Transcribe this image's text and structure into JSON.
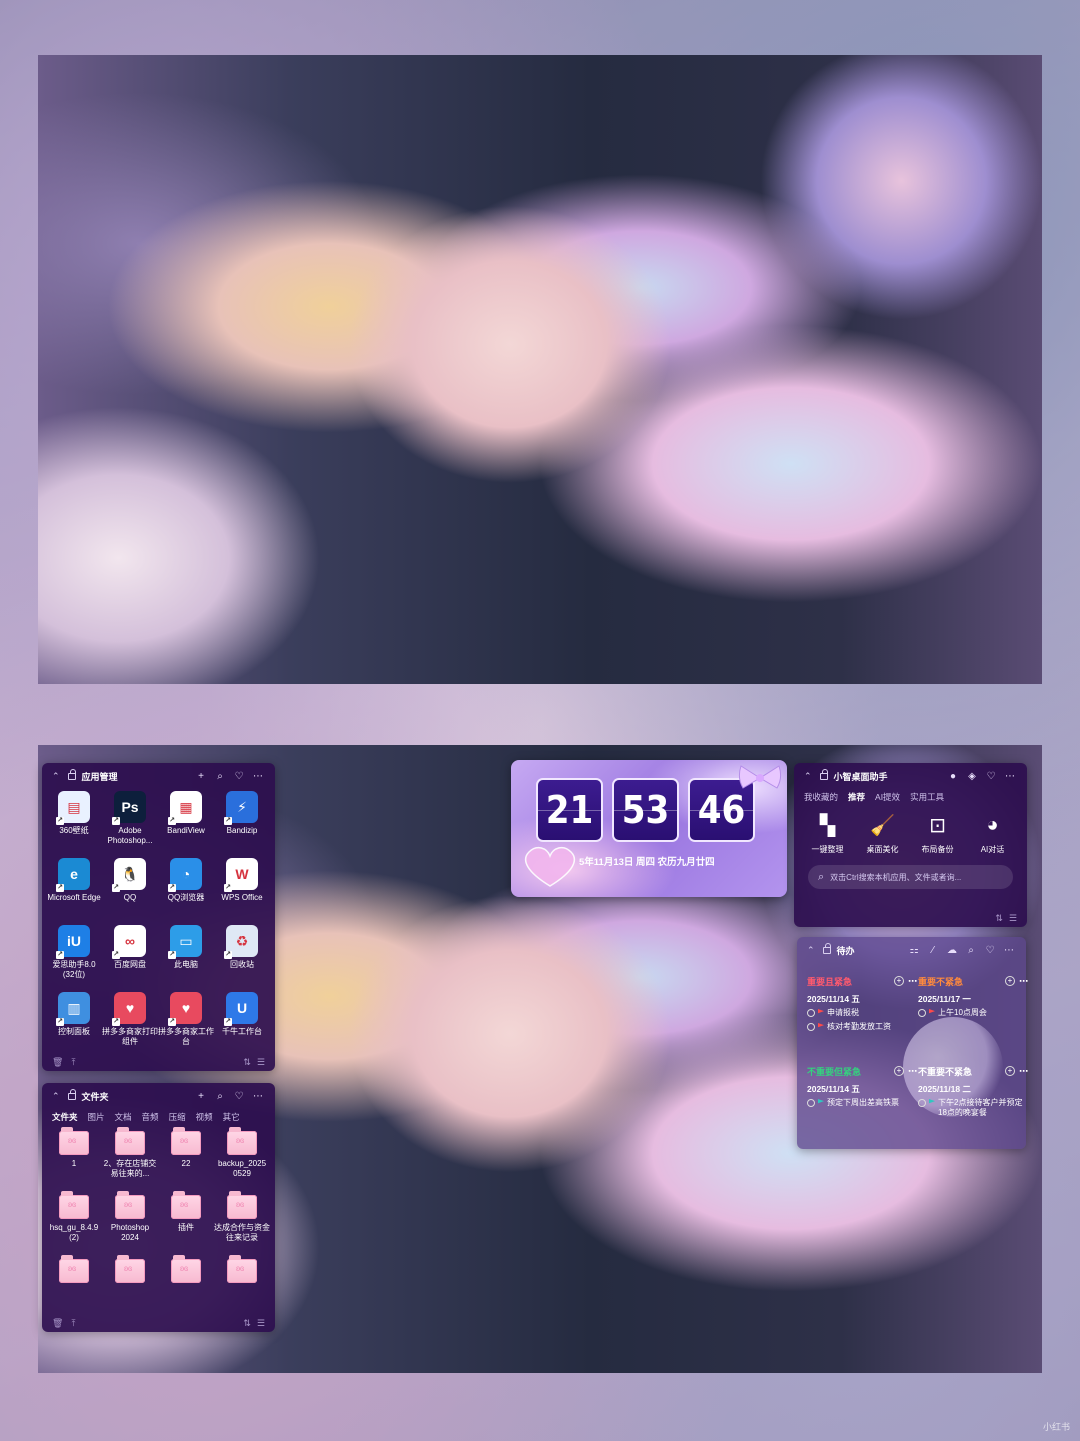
{
  "app_panel": {
    "title": "应用管理",
    "apps": [
      {
        "label": "360壁纸",
        "icon": "360-wallpaper-icon",
        "color": "#e9f1ff",
        "glyph": "▤"
      },
      {
        "label": "Adobe Photoshop...",
        "icon": "photoshop-icon",
        "color": "#0d1f3c",
        "glyph": "Ps"
      },
      {
        "label": "BandiView",
        "icon": "bandiview-icon",
        "color": "#ffffff",
        "glyph": "▦"
      },
      {
        "label": "Bandizip",
        "icon": "bandizip-icon",
        "color": "#2a6fdc",
        "glyph": "⚡"
      },
      {
        "label": "Microsoft Edge",
        "icon": "edge-icon",
        "color": "#1b8ad3",
        "glyph": "e"
      },
      {
        "label": "QQ",
        "icon": "qq-icon",
        "color": "#ffffff",
        "glyph": "🐧"
      },
      {
        "label": "QQ浏览器",
        "icon": "qq-browser-icon",
        "color": "#2a8fe8",
        "glyph": "◔"
      },
      {
        "label": "WPS Office",
        "icon": "wps-office-icon",
        "color": "#ffffff",
        "glyph": "W"
      },
      {
        "label": "爱思助手8.0 (32位)",
        "icon": "i4-assistant-icon",
        "color": "#1e7fe6",
        "glyph": "iU"
      },
      {
        "label": "百度网盘",
        "icon": "baidu-netdisk-icon",
        "color": "#ffffff",
        "glyph": "∞"
      },
      {
        "label": "此电脑",
        "icon": "this-pc-icon",
        "color": "#2d9de8",
        "glyph": "▭"
      },
      {
        "label": "回收站",
        "icon": "recycle-bin-icon",
        "color": "#dfe8f5",
        "glyph": "♻"
      },
      {
        "label": "控制面板",
        "icon": "control-panel-icon",
        "color": "#3f8fe0",
        "glyph": "▥"
      },
      {
        "label": "拼多多商家打印组件",
        "icon": "pdd-print-icon",
        "color": "#e84a5f",
        "glyph": "♥"
      },
      {
        "label": "拼多多商家工作台",
        "icon": "pdd-workbench-icon",
        "color": "#e84a5f",
        "glyph": "♥"
      },
      {
        "label": "千牛工作台",
        "icon": "qianniu-icon",
        "color": "#2e79e8",
        "glyph": "U"
      }
    ]
  },
  "folder_panel": {
    "title": "文件夹",
    "tabs": [
      "文件夹",
      "图片",
      "文档",
      "音频",
      "压缩",
      "视频",
      "其它"
    ],
    "active_tab": "文件夹",
    "folders": [
      {
        "label": "1"
      },
      {
        "label": "2、存在店铺交易往来的..."
      },
      {
        "label": "22"
      },
      {
        "label": "backup_2025 0529"
      },
      {
        "label": "hsq_gu_8.4.9 (2)"
      },
      {
        "label": "Photoshop 2024"
      },
      {
        "label": "插件"
      },
      {
        "label": "达成合作与资金往来记录"
      },
      {
        "label": ""
      },
      {
        "label": ""
      },
      {
        "label": ""
      },
      {
        "label": ""
      }
    ]
  },
  "clock": {
    "hours": "21",
    "minutes": "53",
    "seconds": "46",
    "date_line": "5年11月13日 周四 农历九月廿四"
  },
  "assistant": {
    "title": "小智桌面助手",
    "tabs": [
      "我收藏的",
      "推荐",
      "AI提效",
      "实用工具"
    ],
    "active_tab": "推荐",
    "tools": [
      {
        "label": "一键整理",
        "icon": "organize-icon",
        "glyph": "▚"
      },
      {
        "label": "桌面美化",
        "icon": "beautify-icon",
        "glyph": "🧹"
      },
      {
        "label": "布局备份",
        "icon": "backup-icon",
        "glyph": "⊡"
      },
      {
        "label": "AI对话",
        "icon": "ai-chat-icon",
        "glyph": "◕"
      }
    ],
    "search_placeholder": "双击Ctrl搜索本机应用、文件或者询..."
  },
  "todo": {
    "title": "待办",
    "quadrants": [
      {
        "title": "重要且紧急",
        "title_color": "#ff5a6e",
        "date": "2025/11/14 五",
        "tasks": [
          {
            "text": "申请报税",
            "flag": "#ff4a4a"
          },
          {
            "text": "核对考勤发放工资",
            "flag": "#ff4a4a"
          }
        ]
      },
      {
        "title": "重要不紧急",
        "title_color": "#ff8a3d",
        "date": "2025/11/17 一",
        "tasks": [
          {
            "text": "上午10点周会",
            "flag": "#ff4a4a"
          }
        ]
      },
      {
        "title": "不重要但紧急",
        "title_color": "#35d07f",
        "date": "2025/11/14 五",
        "tasks": [
          {
            "text": "预定下周出差高铁票",
            "flag": "#2fc7c0"
          }
        ]
      },
      {
        "title": "不重要不紧急",
        "title_color": "#ffffff",
        "date": "2025/11/18 二",
        "tasks": [
          {
            "text": "下午2点接待客户并预定18点的晚宴餐",
            "flag": "#2fc7c0"
          }
        ]
      }
    ]
  },
  "watermark": "小红书"
}
